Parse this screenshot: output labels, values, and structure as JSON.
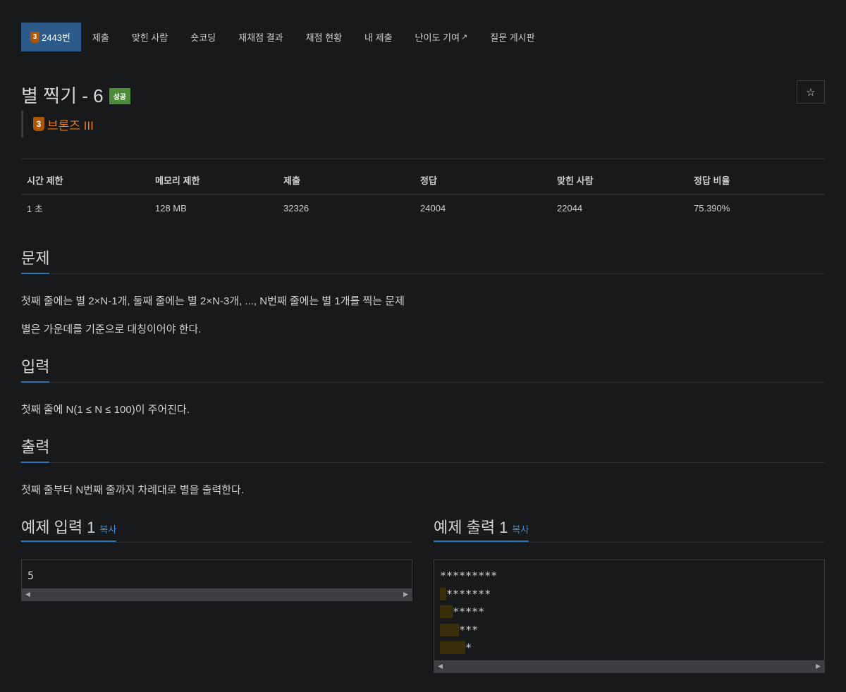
{
  "tabs": [
    {
      "label": "2443번",
      "tier_digit": "3",
      "active": true
    },
    {
      "label": "제출"
    },
    {
      "label": "맞힌 사람"
    },
    {
      "label": "숏코딩"
    },
    {
      "label": "재채점 결과"
    },
    {
      "label": "채점 현황"
    },
    {
      "label": "내 제출"
    },
    {
      "label": "난이도 기여",
      "external": true
    },
    {
      "label": "질문 게시판"
    }
  ],
  "problem": {
    "title": "별 찍기 - 6",
    "status_label": "성공",
    "tier_digit": "3",
    "tier_name": "브론즈 III",
    "star_icon": "☆"
  },
  "stats": {
    "headers": [
      "시간 제한",
      "메모리 제한",
      "제출",
      "정답",
      "맞힌 사람",
      "정답 비율"
    ],
    "values": [
      "1 초",
      "128 MB",
      "32326",
      "24004",
      "22044",
      "75.390%"
    ]
  },
  "sections": {
    "problem_heading": "문제",
    "problem_lines": [
      "첫째 줄에는 별 2×N-1개, 둘째 줄에는 별 2×N-3개, ..., N번째 줄에는 별 1개를 찍는 문제",
      "별은 가운데를 기준으로 대칭이어야 한다."
    ],
    "input_heading": "입력",
    "input_text": "첫째 줄에 N(1 ≤ N ≤ 100)이 주어진다.",
    "output_heading": "출력",
    "output_text": "첫째 줄부터 N번째 줄까지 차례대로 별을 출력한다."
  },
  "samples": {
    "input_heading": "예제 입력 1",
    "output_heading": "예제 출력 1",
    "copy_label": "복사",
    "input_text": "5",
    "output_lines": [
      {
        "spaces": "",
        "stars": "*********"
      },
      {
        "spaces": " ",
        "stars": "*******"
      },
      {
        "spaces": "  ",
        "stars": "*****"
      },
      {
        "spaces": "   ",
        "stars": "***"
      },
      {
        "spaces": "    ",
        "stars": "*"
      }
    ]
  },
  "colors": {
    "active_tab": "#2c5b8a",
    "bronze": "#ad5600",
    "tier_text": "#ea7c1f",
    "success": "#4c8c3a",
    "accent_underline": "#2b74b8",
    "whitespace_highlight": "#3a2f0a"
  }
}
